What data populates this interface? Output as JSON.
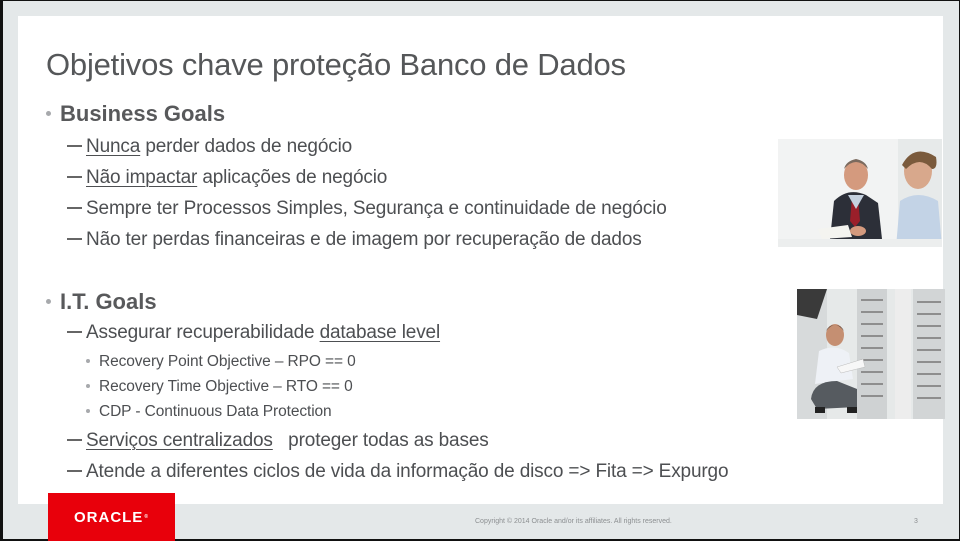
{
  "slide": {
    "title": "Objetivos chave proteção Banco de Dados",
    "sections": [
      {
        "heading": "Business Goals",
        "items": [
          {
            "underlined": "Nunca",
            "rest": " perder dados de negócio"
          },
          {
            "underlined": "Não impactar",
            "rest": " aplicações de negócio"
          },
          {
            "underlined": "",
            "rest": "Sempre ter Processos Simples, Segurança e continuidade de negócio"
          },
          {
            "underlined": "",
            "rest": "Não ter perdas financeiras e de imagem por  recuperação de dados"
          }
        ]
      },
      {
        "heading": "I.T. Goals",
        "items": [
          {
            "prefix": "Assegurar recuperabilidade ",
            "underlined": "database level"
          },
          {
            "underlined": "Serviços centralizados",
            "rest": "   proteger todas as bases"
          },
          {
            "underlined": "",
            "rest": "Atende a diferentes ciclos de vida da informação de disco => Fita => Expurgo"
          }
        ],
        "subitems": [
          "Recovery Point Objective – RPO == 0",
          "Recovery Time Objective – RTO == 0",
          "CDP - Continuous Data Protection"
        ]
      }
    ],
    "images": [
      {
        "name": "business-meeting-photo",
        "description": "two men discussing a document"
      },
      {
        "name": "datacenter-photo",
        "description": "man with tablet crouching by server racks"
      }
    ]
  },
  "footer": {
    "logo": "ORACLE",
    "copyright": "Copyright © 2014 Oracle and/or its affiliates. All rights reserved.",
    "page_number": "3"
  },
  "colors": {
    "brand_red": "#e8000b",
    "text": "#4d4f52",
    "frame": "#e4e8e9"
  }
}
